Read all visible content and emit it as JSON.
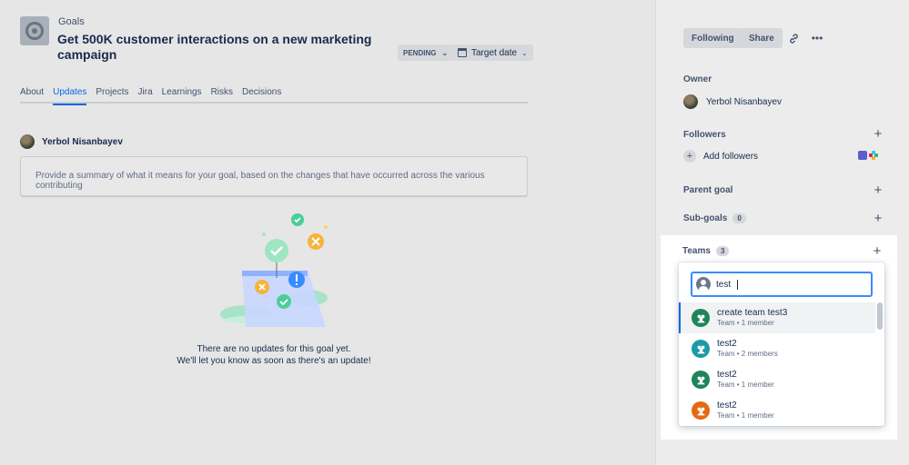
{
  "header": {
    "breadcrumb": "Goals",
    "title": "Get 500K customer interactions on a new marketing campaign",
    "status": "PENDING",
    "target_date": "Target date"
  },
  "tabs": [
    {
      "label": "About"
    },
    {
      "label": "Updates"
    },
    {
      "label": "Projects"
    },
    {
      "label": "Jira"
    },
    {
      "label": "Learnings"
    },
    {
      "label": "Risks"
    },
    {
      "label": "Decisions"
    }
  ],
  "active_tab": "Updates",
  "update": {
    "author": "Yerbol Nisanbayev",
    "summary_placeholder": "Provide a summary of what it means for your goal, based on the changes that have occurred across the various contributing"
  },
  "empty_state": {
    "line1": "There are no updates for this goal yet.",
    "line2": "We'll let you know as soon as there's an update!"
  },
  "sidebar": {
    "following_label": "Following",
    "share_label": "Share",
    "owner_label": "Owner",
    "owner_name": "Yerbol Nisanbayev",
    "followers_label": "Followers",
    "add_followers_label": "Add followers",
    "parent_goal_label": "Parent goal",
    "subgoals_label": "Sub-goals",
    "subgoals_count": "0",
    "teams_label": "Teams",
    "teams_count": "3"
  },
  "team_search": {
    "query": "test",
    "options": [
      {
        "name": "create team test3",
        "sub": "Team • 1 member",
        "color": "#1F845A"
      },
      {
        "name": "test2",
        "sub": "Team • 2 members",
        "color": "#1D9AAA"
      },
      {
        "name": "test2",
        "sub": "Team • 1 member",
        "color": "#1F845A"
      },
      {
        "name": "test2",
        "sub": "Team • 1 member",
        "color": "#E56910"
      }
    ]
  },
  "colors": {
    "accent": "#0C66E4",
    "focus": "#388BFF"
  }
}
